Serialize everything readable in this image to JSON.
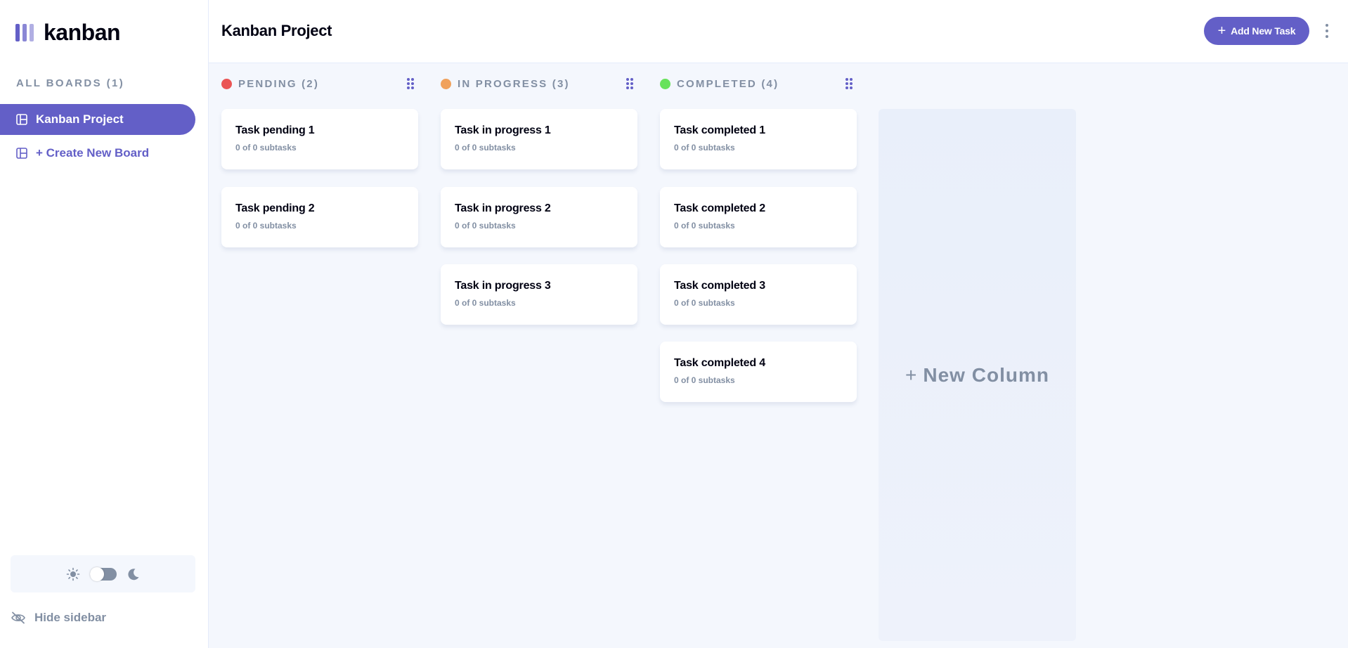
{
  "app": {
    "logo_text": "kanban"
  },
  "sidebar": {
    "heading": "ALL BOARDS (1)",
    "boards": [
      {
        "label": "Kanban Project",
        "active": true
      }
    ],
    "create_label": "+ Create New Board",
    "hide_label": "Hide sidebar",
    "theme": "light"
  },
  "header": {
    "title": "Kanban Project",
    "add_task_label": "Add New Task"
  },
  "columns": [
    {
      "title": "PENDING (2)",
      "color": "#ea5555",
      "tasks": [
        {
          "title": "Task pending 1",
          "subtasks": "0 of 0 subtasks"
        },
        {
          "title": "Task pending 2",
          "subtasks": "0 of 0 subtasks"
        }
      ]
    },
    {
      "title": "IN PROGRESS (3)",
      "color": "#f0a15c",
      "tasks": [
        {
          "title": "Task in progress 1",
          "subtasks": "0 of 0 subtasks"
        },
        {
          "title": "Task in progress 2",
          "subtasks": "0 of 0 subtasks"
        },
        {
          "title": "Task in progress 3",
          "subtasks": "0 of 0 subtasks"
        }
      ]
    },
    {
      "title": "COMPLETED (4)",
      "color": "#67e25b",
      "tasks": [
        {
          "title": "Task completed 1",
          "subtasks": "0 of 0 subtasks"
        },
        {
          "title": "Task completed 2",
          "subtasks": "0 of 0 subtasks"
        },
        {
          "title": "Task completed 3",
          "subtasks": "0 of 0 subtasks"
        },
        {
          "title": "Task completed 4",
          "subtasks": "0 of 0 subtasks"
        }
      ]
    }
  ],
  "new_column_label": "New Column",
  "colors": {
    "accent": "#635fc7",
    "muted": "#828fa3",
    "background": "#f4f7fd"
  },
  "icons": [
    "logo-bars-icon",
    "board-icon",
    "sun-icon",
    "moon-icon",
    "eye-slash-icon",
    "plus-icon",
    "vertical-ellipsis-icon",
    "drag-handle-icon"
  ]
}
